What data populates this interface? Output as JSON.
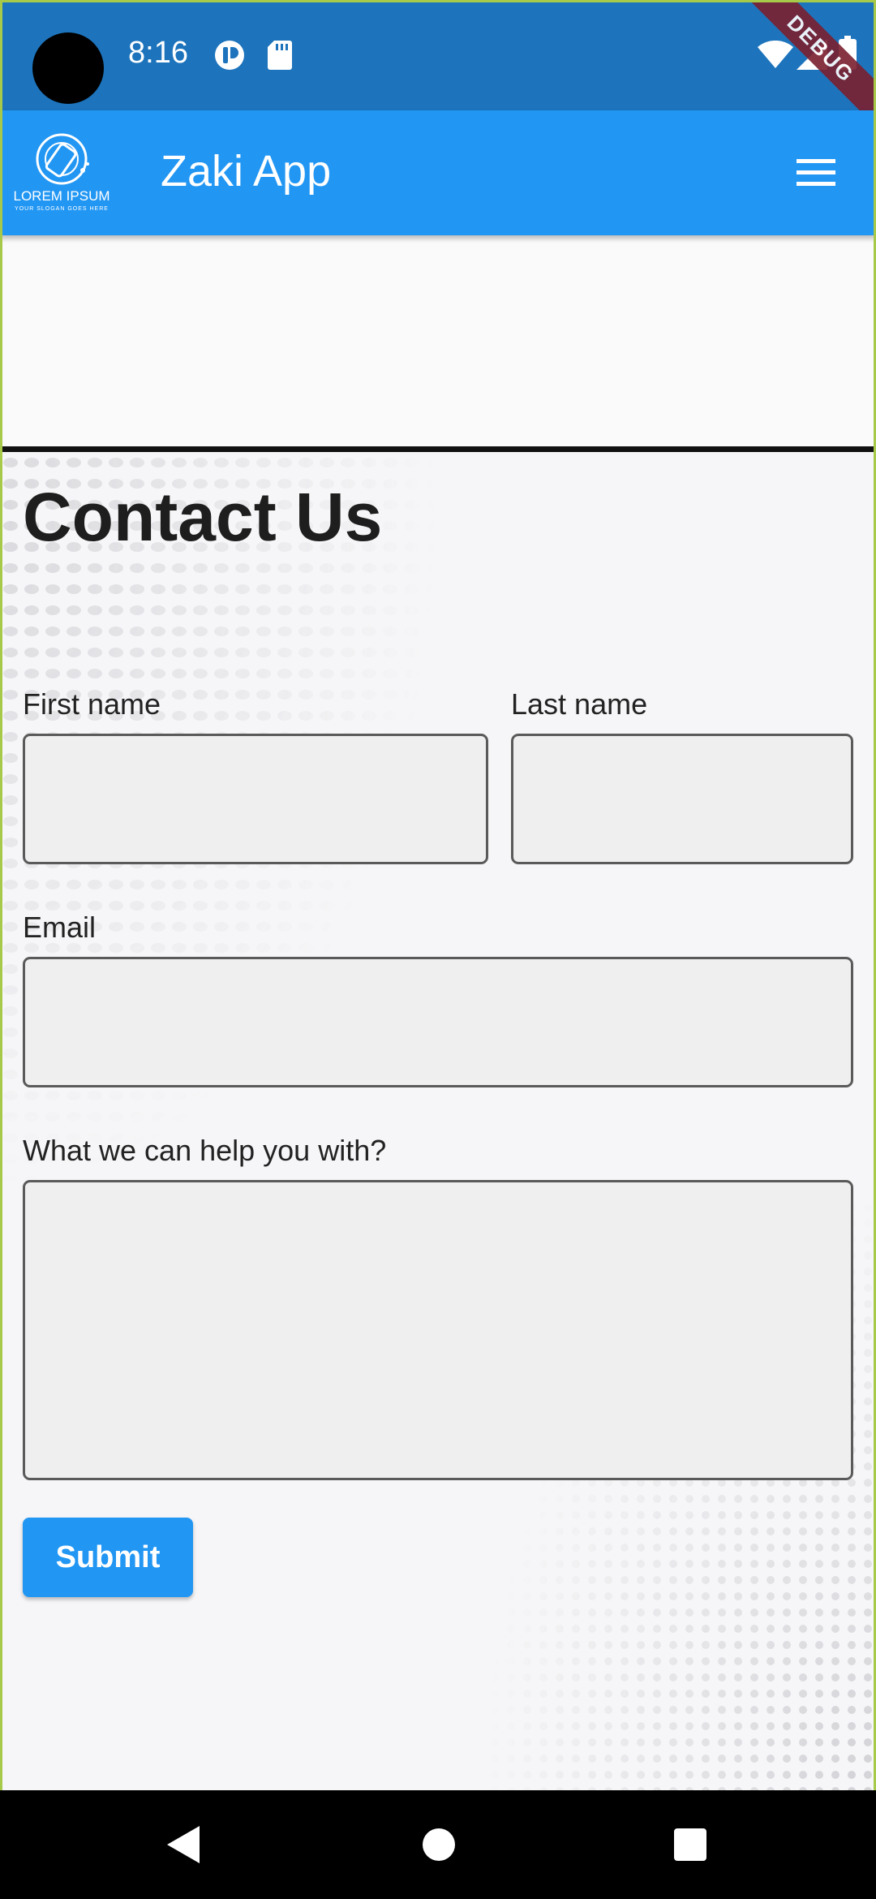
{
  "status_bar": {
    "time": "8:16",
    "icons": [
      "camera-hole",
      "notification-icon",
      "sd-card-icon",
      "wifi-icon",
      "signal-icon",
      "battery-icon"
    ],
    "debug_banner": "DEBUG"
  },
  "app_bar": {
    "logo_text": "LOREM IPSUM",
    "logo_tagline": "YOUR SLOGAN GOES HERE",
    "title": "Zaki App",
    "menu_icon": "hamburger-menu-icon",
    "background_color": "#2196f3"
  },
  "form": {
    "title": "Contact Us",
    "first_name_label": "First name",
    "first_name_value": "",
    "last_name_label": "Last name",
    "last_name_value": "",
    "email_label": "Email",
    "email_value": "",
    "help_label": "What we can help you with?",
    "help_value": "",
    "submit_label": "Submit"
  },
  "nav_bar": {
    "icons": [
      "back-icon",
      "home-icon",
      "recents-icon"
    ]
  }
}
